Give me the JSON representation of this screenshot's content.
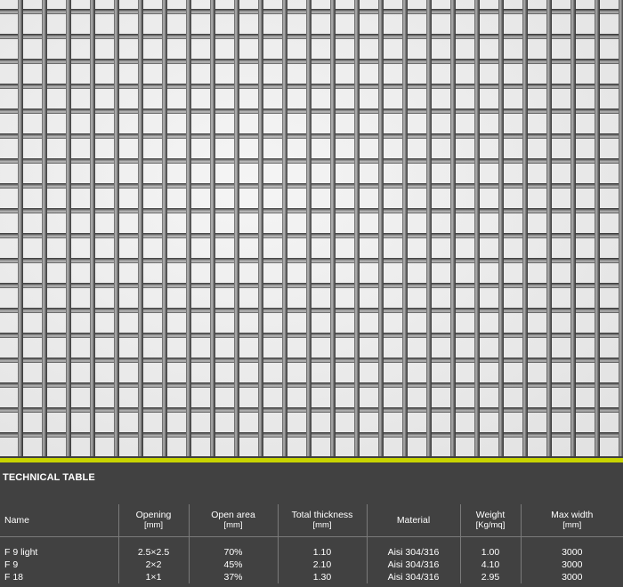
{
  "table": {
    "title": "TECHNICAL TABLE",
    "columns": [
      {
        "label": "Name",
        "unit": ""
      },
      {
        "label": "Opening",
        "unit": "[mm]"
      },
      {
        "label": "Open area",
        "unit": "[mm]"
      },
      {
        "label": "Total thickness",
        "unit": "[mm]"
      },
      {
        "label": "Material",
        "unit": ""
      },
      {
        "label": "Weight",
        "unit": "[Kg/mq]"
      },
      {
        "label": "Max width",
        "unit": "[mm]"
      }
    ],
    "rows": [
      [
        "F 9 light",
        "2.5×2.5",
        "70%",
        "1.10",
        "Aisi 304/316",
        "1.00",
        "3000"
      ],
      [
        "F 9",
        "2×2",
        "45%",
        "2.10",
        "Aisi 304/316",
        "4.10",
        "3000"
      ],
      [
        "F 18",
        "1×1",
        "37%",
        "1.30",
        "Aisi 304/316",
        "2.95",
        "3000"
      ]
    ]
  },
  "colors": {
    "accent": "#c8d400",
    "panel_background": "#414141"
  }
}
